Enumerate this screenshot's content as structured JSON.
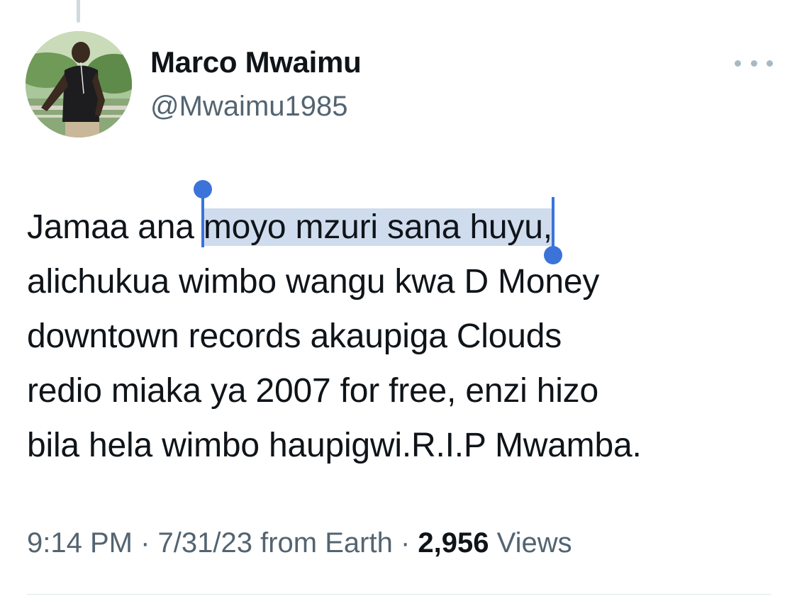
{
  "tweet": {
    "author": {
      "display_name": "Marco Mwaimu",
      "handle": "@Mwaimu1985"
    },
    "text_lines": [
      {
        "before": "Jamaa ana ",
        "selected": "moyo mzuri sana huyu,",
        "after": ""
      },
      "alichukua wimbo wangu kwa D Money",
      "downtown records akaupiga Clouds",
      "redio miaka ya 2007 for free, enzi hizo",
      "bila hela wimbo haupigwi.R.I.P Mwamba."
    ],
    "meta": {
      "time": "9:14 PM",
      "separator": " · ",
      "date": "7/31/23",
      "source": "from Earth",
      "views_count": "2,956",
      "views_label": "Views"
    }
  },
  "icons": {
    "more": "more-horizontal-icon",
    "avatar": "profile-photo"
  },
  "colors": {
    "text_primary": "#0f1419",
    "text_secondary": "#536471",
    "selection_highlight": "#cfdcee",
    "selection_handle": "#3b73d9"
  }
}
